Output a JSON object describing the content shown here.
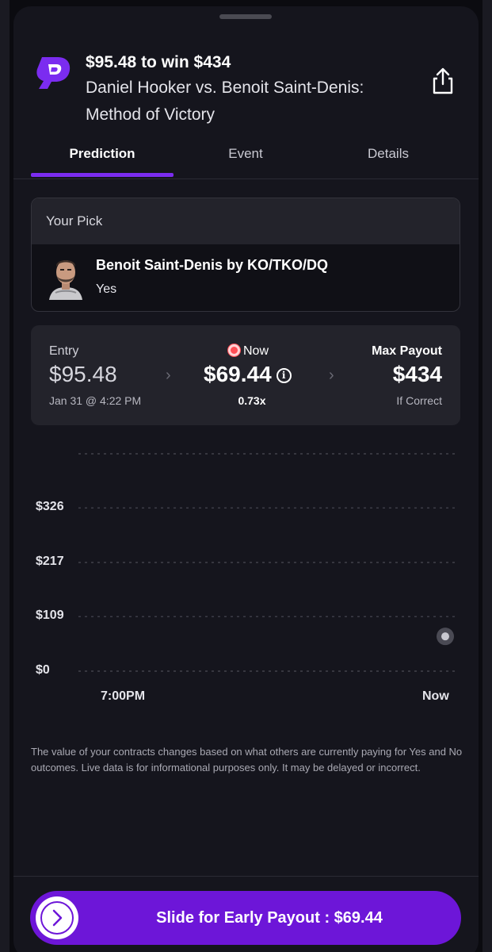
{
  "header": {
    "title": "$95.48 to win $434",
    "subtitle_line1": "Daniel Hooker vs. Benoit Saint-Denis:",
    "subtitle_line2": "Method of Victory",
    "share_icon": "share-icon"
  },
  "tabs": [
    {
      "label": "Prediction",
      "active": true
    },
    {
      "label": "Event",
      "active": false
    },
    {
      "label": "Details",
      "active": false
    }
  ],
  "pick": {
    "heading": "Your Pick",
    "selection": "Benoit Saint-Denis by KO/TKO/DQ",
    "answer": "Yes"
  },
  "stats": {
    "entry_label": "Entry",
    "entry_value": "$95.48",
    "entry_time": "Jan 31 @ 4:22 PM",
    "now_label": "Now",
    "now_value": "$69.44",
    "now_multiplier": "0.73x",
    "max_label": "Max Payout",
    "max_value": "$434",
    "max_sub": "If Correct"
  },
  "chart_data": {
    "type": "line",
    "title": "",
    "xlabel": "",
    "ylabel": "",
    "y_ticks": [
      "$326",
      "$217",
      "$109",
      "$0"
    ],
    "x_ticks": [
      "7:00PM",
      "Now"
    ],
    "ylim": [
      0,
      434
    ],
    "series": [
      {
        "points": [
          {
            "x": "Now",
            "y": 69.44
          }
        ]
      }
    ],
    "grid": true,
    "grid_style": "dashed",
    "marker_color": "#c8c8d0"
  },
  "disclaimer": "The value of your contracts changes based on what others are currently paying for Yes and No outcomes. Live data is for informational purposes only. It may be delayed or incorrect.",
  "cta": {
    "label": "Slide for Early Payout : $69.44",
    "knob_icon": "chevron-right-icon"
  },
  "colors": {
    "accent": "#6d16d8",
    "tab_indicator": "#7b2cf0",
    "live": "#ff4d55"
  }
}
